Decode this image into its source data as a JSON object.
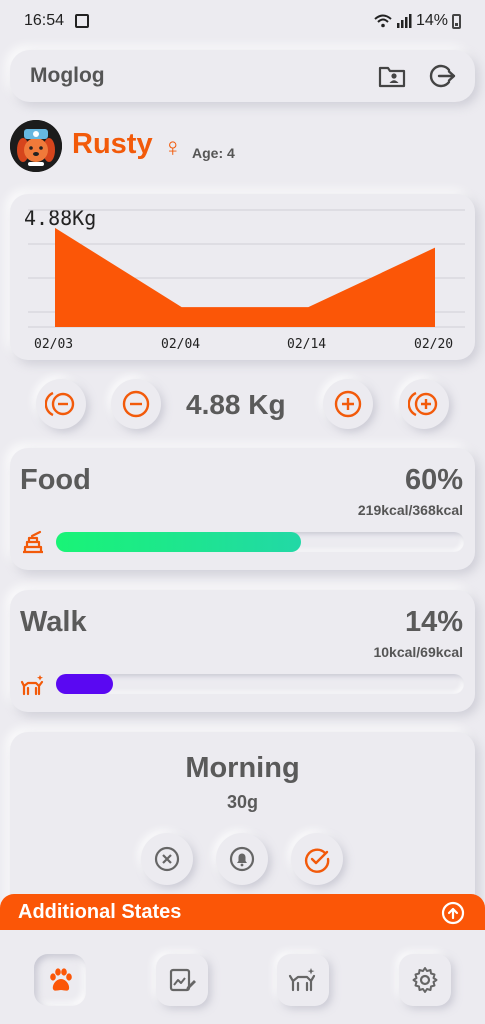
{
  "status_bar": {
    "time": "16:54",
    "battery": "14%"
  },
  "app_bar": {
    "title": "Moglog"
  },
  "pet": {
    "name": "Rusty",
    "gender_symbol": "♀",
    "age_label": "Age: 4"
  },
  "chart_data": {
    "type": "area",
    "title": "4.88Kg",
    "x": [
      "02/03",
      "02/04",
      "02/14",
      "02/20"
    ],
    "values": [
      5.1,
      4.7,
      4.7,
      5.0
    ],
    "ylim": [
      4.6,
      5.2
    ],
    "grid": true,
    "color": "#fb5607"
  },
  "weight": {
    "display": "4.88 Kg"
  },
  "food": {
    "title": "Food",
    "percent": "60%",
    "kcal": "219kcal/368kcal",
    "progress": 0.6
  },
  "walk": {
    "title": "Walk",
    "percent": "14%",
    "kcal": "10kcal/69kcal",
    "progress": 0.14
  },
  "meal": {
    "title": "Morning",
    "amount": "30g"
  },
  "additional": {
    "title": "Additional States"
  },
  "colors": {
    "accent": "#fb5607",
    "food_start": "#19f476",
    "food_end": "#22d8a6",
    "walk": "#5a08f2"
  },
  "nav": {
    "items": [
      "paw-icon",
      "chart-edit-icon",
      "dog-walk-icon",
      "settings-icon"
    ]
  }
}
